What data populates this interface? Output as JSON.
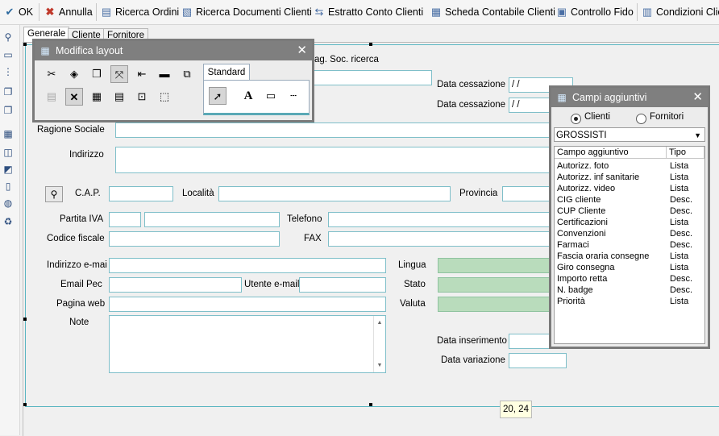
{
  "toolbar": {
    "items": [
      "OK",
      "Annulla",
      "Ricerca Ordini",
      "Ricerca Documenti Clienti",
      "Estratto Conto Clienti",
      "Scheda Contabile Clienti",
      "Controllo Fido",
      "Condizioni Clienti"
    ]
  },
  "tabs": [
    "Generale",
    "Cliente",
    "Fornitore"
  ],
  "form": {
    "rag_soc_ricerca_label": "ag. Soc. ricerca",
    "data_cessazione_label": "Data cessazione",
    "data_cessazione_value": "/ /",
    "data_cessazione2_value": "/ /",
    "ragione_sociale_label": "Ragione Sociale",
    "indirizzo_label": "Indirizzo",
    "cap_label": "C.A.P.",
    "localita_label": "Località",
    "provincia_label": "Provincia",
    "partita_iva_label": "Partita IVA",
    "telefono_label": "Telefono",
    "codice_fiscale_label": "Codice fiscale",
    "fax_label": "FAX",
    "email_label": "Indirizzo e-mai",
    "lingua_label": "Lingua",
    "pec_label": "Email Pec",
    "utente_email_label": "Utente e-mail",
    "stato_label": "Stato",
    "pagina_web_label": "Pagina web",
    "valuta_label": "Valuta",
    "note_label": "Note",
    "data_inserimento_label": "Data inserimento",
    "data_variazione_label": "Data variazione"
  },
  "modifica_layout": {
    "title": "Modifica layout",
    "tab_label": "Standard",
    "tool_text_glyph": "A"
  },
  "campi": {
    "title": "Campi aggiuntivi",
    "radio_clienti": "Clienti",
    "radio_fornitori": "Fornitori",
    "selected_group": "GROSSISTI",
    "col_campo": "Campo aggiuntivo",
    "col_tipo": "Tipo",
    "rows": [
      {
        "campo": "Autorizz. foto",
        "tipo": "Lista"
      },
      {
        "campo": "Autorizz. inf sanitarie",
        "tipo": "Lista"
      },
      {
        "campo": "Autorizz. video",
        "tipo": "Lista"
      },
      {
        "campo": "CIG cliente",
        "tipo": "Desc."
      },
      {
        "campo": "CUP Cliente",
        "tipo": "Desc."
      },
      {
        "campo": "Certificazioni",
        "tipo": "Lista"
      },
      {
        "campo": "Convenzioni",
        "tipo": "Desc."
      },
      {
        "campo": "Farmaci",
        "tipo": "Desc."
      },
      {
        "campo": "Fascia oraria consegne",
        "tipo": "Lista"
      },
      {
        "campo": "Giro consegna",
        "tipo": "Lista"
      },
      {
        "campo": "Importo retta",
        "tipo": "Desc."
      },
      {
        "campo": "N. badge",
        "tipo": "Desc."
      },
      {
        "campo": "Priorità",
        "tipo": "Lista"
      }
    ]
  },
  "coord_tooltip": "20, 24"
}
